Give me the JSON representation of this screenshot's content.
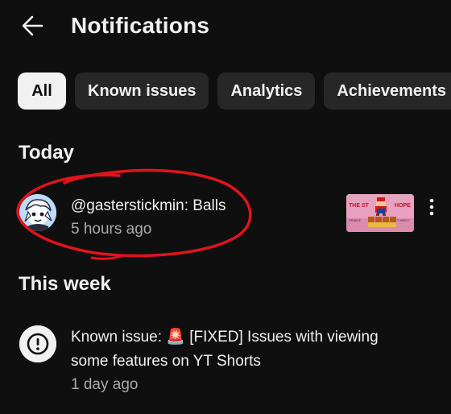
{
  "header": {
    "title": "Notifications"
  },
  "chips": [
    {
      "label": "All",
      "selected": true
    },
    {
      "label": "Known issues",
      "selected": false
    },
    {
      "label": "Analytics",
      "selected": false
    },
    {
      "label": "Achievements",
      "selected": false
    }
  ],
  "sections": {
    "today": "Today",
    "this_week": "This week"
  },
  "notifications": [
    {
      "author": "@gasterstickmin",
      "message": ": Balls",
      "time": "5 hours ago",
      "avatar_icon": "anime-avatar-icon",
      "thumbnail": {
        "text_left": "THE ST",
        "text_right": "HOPE",
        "text_small_left": "PRINCE",
        "text_small_right": "T HER C",
        "bg_color": "#e8a2bf"
      }
    },
    {
      "prefix": "Known issue: ",
      "emoji": "🚨",
      "message_line1": " [FIXED] Issues with viewing",
      "message_line2": "some features on YT Shorts",
      "time": "1 day ago",
      "icon": "info-icon"
    }
  ],
  "colors": {
    "background": "#0f0f0f",
    "chip_bg": "#272727",
    "chip_selected_bg": "#f1f1f1",
    "text_primary": "#f1f1f1",
    "text_secondary": "#aaaaaa",
    "annotation_red": "#e0141c"
  }
}
